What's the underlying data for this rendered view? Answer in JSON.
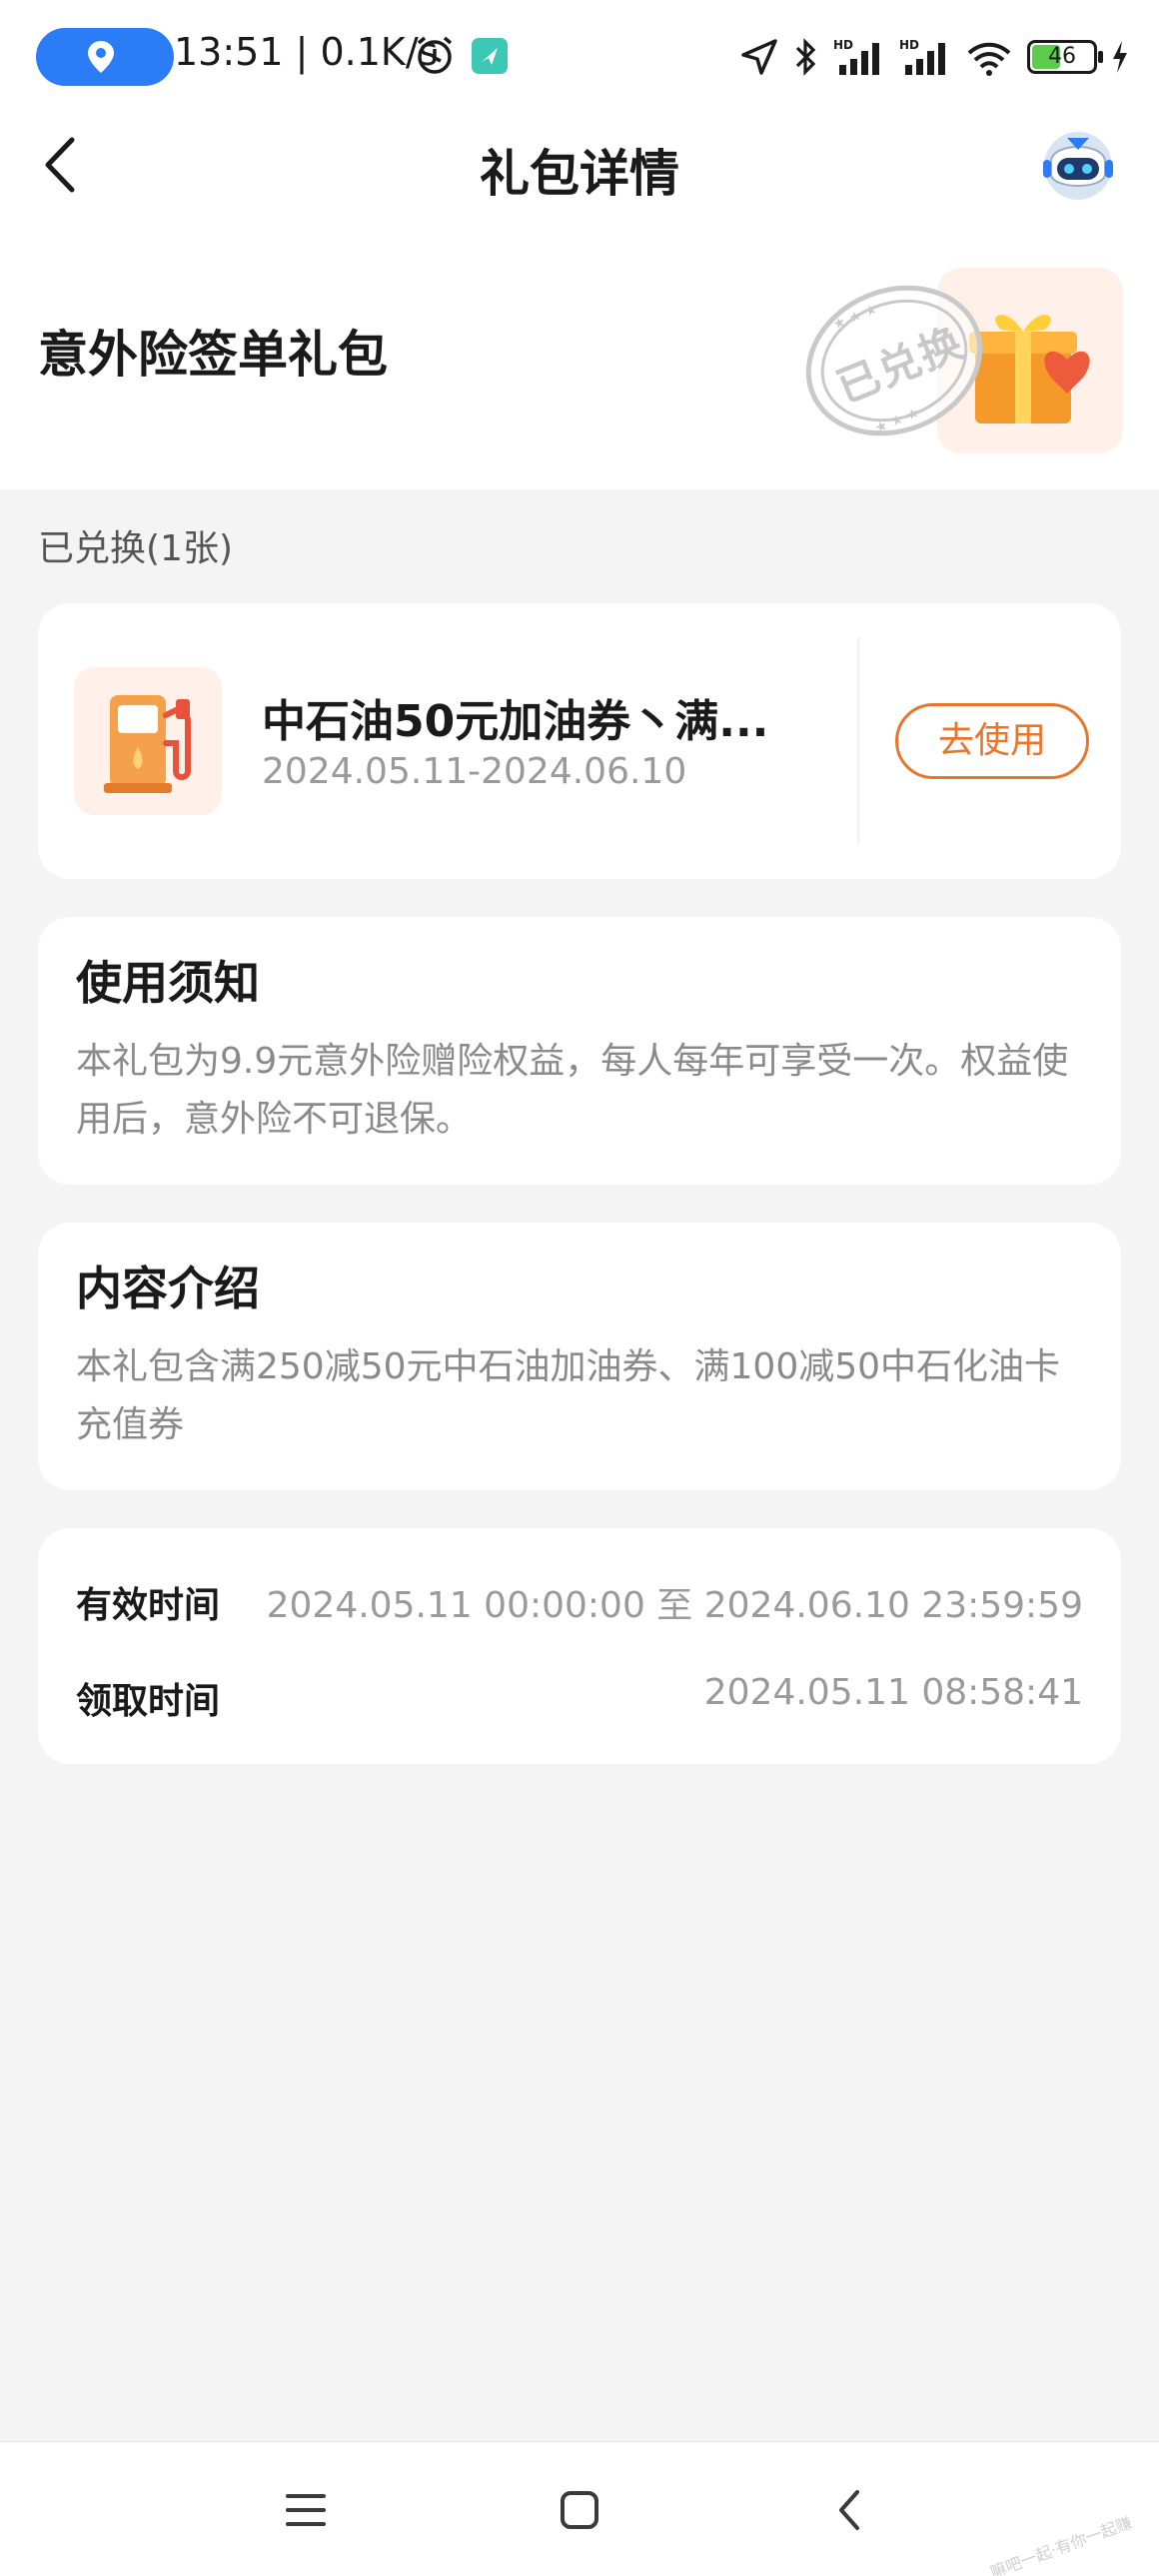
{
  "status_bar": {
    "time_speed": "13:51 | 0.1K/s",
    "battery": "46"
  },
  "nav": {
    "title": "礼包详情"
  },
  "package": {
    "title": "意外险签单礼包",
    "stamp": "已兑换"
  },
  "redeemed_label": "已兑换(1张)",
  "coupon": {
    "title": "中石油50元加油券丶满...",
    "date_range": "2024.05.11-2024.06.10",
    "use_button": "去使用"
  },
  "notice": {
    "heading": "使用须知",
    "body": "本礼包为9.9元意外险赠险权益，每人每年可享受一次。权益使用后，意外险不可退保。"
  },
  "content_intro": {
    "heading": "内容介绍",
    "body": "本礼包含满250减50元中石油加油券、满100减50中石化油卡充值券"
  },
  "validity": {
    "valid_label": "有效时间",
    "valid_value": "2024.05.11 00:00:00 至 2024.06.10 23:59:59",
    "claim_label": "领取时间",
    "claim_value": "2024.05.11 08:58:41"
  },
  "colors": {
    "accent": "#e8752a",
    "location_pill": "#2a7df6",
    "background": "#f4f4f4"
  },
  "watermark": "嘛吧一起·有你一起赚"
}
